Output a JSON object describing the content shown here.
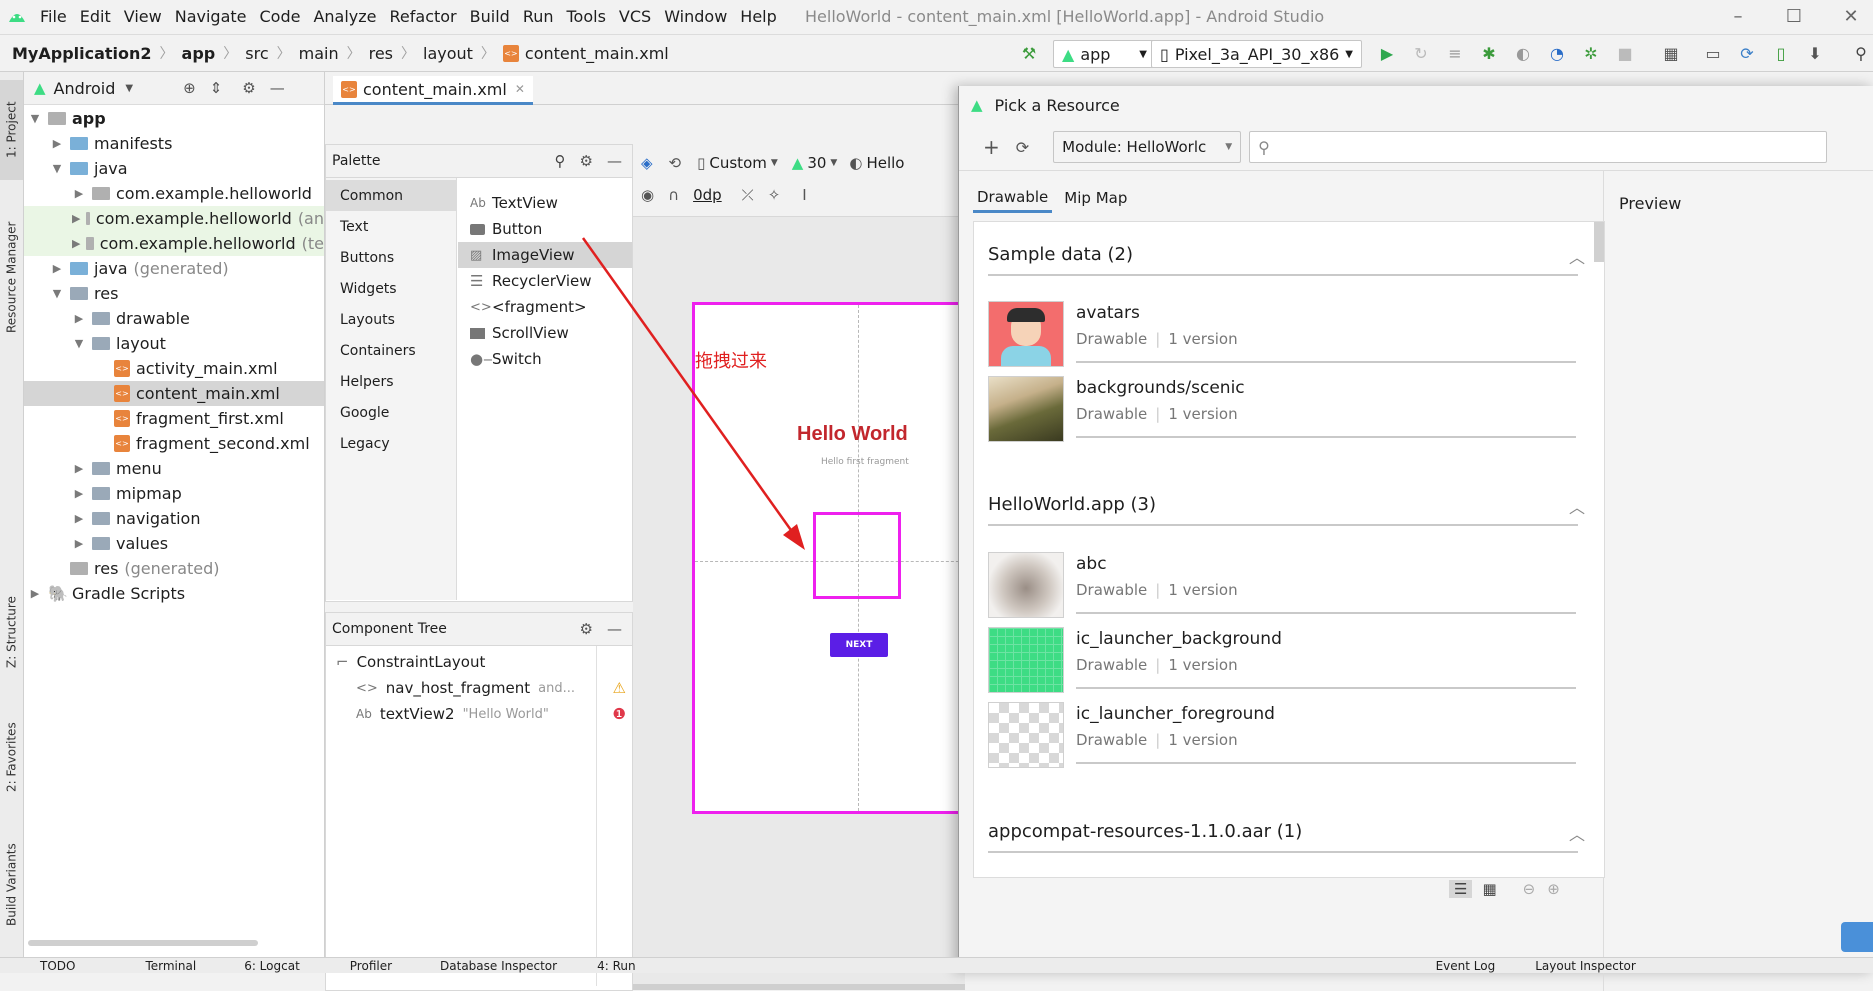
{
  "window": {
    "title": "HelloWorld - content_main.xml [HelloWorld.app] - Android Studio"
  },
  "menu": [
    "File",
    "Edit",
    "View",
    "Navigate",
    "Code",
    "Analyze",
    "Refactor",
    "Build",
    "Run",
    "Tools",
    "VCS",
    "Window",
    "Help"
  ],
  "breadcrumb": [
    "MyApplication2",
    "app",
    "src",
    "main",
    "res",
    "layout",
    "content_main.xml"
  ],
  "toolbar": {
    "run_config": "app",
    "device": "Pixel_3a_API_30_x86"
  },
  "project_panel": {
    "view_label": "Android",
    "items": [
      {
        "label": "app"
      },
      {
        "label": "manifests"
      },
      {
        "label": "java"
      },
      {
        "label": "com.example.helloworld"
      },
      {
        "label": "com.example.helloworld",
        "suffix": "(an"
      },
      {
        "label": "com.example.helloworld",
        "suffix": "(te"
      },
      {
        "label": "java",
        "suffix": "(generated)"
      },
      {
        "label": "res"
      },
      {
        "label": "drawable"
      },
      {
        "label": "layout"
      },
      {
        "label": "activity_main.xml"
      },
      {
        "label": "content_main.xml"
      },
      {
        "label": "fragment_first.xml"
      },
      {
        "label": "fragment_second.xml"
      },
      {
        "label": "menu"
      },
      {
        "label": "mipmap"
      },
      {
        "label": "navigation"
      },
      {
        "label": "values"
      },
      {
        "label": "res",
        "suffix": "(generated)"
      },
      {
        "label": "Gradle Scripts"
      }
    ]
  },
  "left_stripe": {
    "project": "1: Project",
    "resource_manager": "Resource Manager",
    "structure": "Z: Structure",
    "favorites": "2: Favorites",
    "build_variants": "Build Variants"
  },
  "editor": {
    "tab": "content_main.xml",
    "palette": {
      "title": "Palette",
      "categories": [
        "Common",
        "Text",
        "Buttons",
        "Widgets",
        "Layouts",
        "Containers",
        "Helpers",
        "Google",
        "Legacy"
      ],
      "items": [
        "TextView",
        "Button",
        "ImageView",
        "RecyclerView",
        "<fragment>",
        "ScrollView",
        "Switch"
      ]
    },
    "component_tree": {
      "title": "Component Tree",
      "root": "ConstraintLayout",
      "children": [
        {
          "name": "nav_host_fragment",
          "detail": "and...",
          "status_color": "#e8a317"
        },
        {
          "name": "textView2",
          "detail": "\"Hello World\"",
          "status_color": "#e0384a"
        }
      ]
    },
    "design_toolbar": {
      "device": "Custom",
      "api": "30",
      "theme": "Hello",
      "margin": "0dp"
    },
    "preview": {
      "hello_text": "Hello World",
      "sub_text": "Hello first fragment",
      "next_button": "NEXT",
      "annotation": "拖拽过来",
      "accent": "#ee20ee"
    }
  },
  "dialog": {
    "title": "Pick a Resource",
    "module": "Module: HelloWorlc",
    "tabs": [
      "Drawable",
      "Mip Map"
    ],
    "preview_label": "Preview",
    "sections": [
      {
        "title": "Sample data (2)",
        "items": [
          {
            "name": "avatars",
            "type": "Drawable",
            "versions": "1 version"
          },
          {
            "name": "backgrounds/scenic",
            "type": "Drawable",
            "versions": "1 version"
          }
        ]
      },
      {
        "title": "HelloWorld.app (3)",
        "items": [
          {
            "name": "abc",
            "type": "Drawable",
            "versions": "1 version"
          },
          {
            "name": "ic_launcher_background",
            "type": "Drawable",
            "versions": "1 version"
          },
          {
            "name": "ic_launcher_foreground",
            "type": "Drawable",
            "versions": "1 version"
          }
        ]
      },
      {
        "title": "appcompat-resources-1.1.0.aar (1)",
        "items": []
      }
    ]
  },
  "bottom_bar": [
    "TODO",
    "Terminal",
    "6: Logcat",
    "Profiler",
    "Database Inspector",
    "4: Run",
    "Event Log",
    "Layout Inspector"
  ]
}
